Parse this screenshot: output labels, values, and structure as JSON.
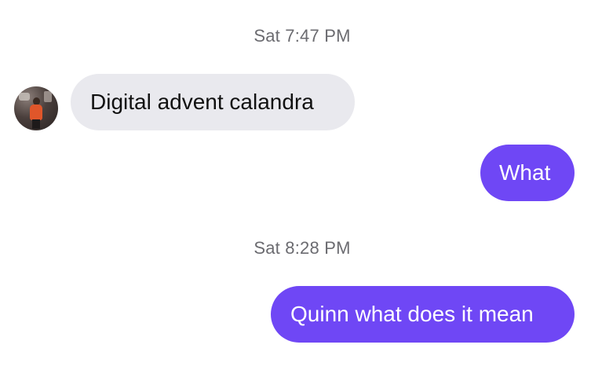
{
  "conversation": {
    "timestamps": [
      "Sat 7:47 PM",
      "Sat 8:28 PM"
    ],
    "messages": [
      {
        "sender": "contact",
        "text": "Digital advent calandra"
      },
      {
        "sender": "me",
        "text": "What"
      },
      {
        "sender": "me",
        "text": "Quinn what does it mean"
      }
    ]
  },
  "colors": {
    "incoming_bubble": "#e9e9ee",
    "outgoing_bubble": "#6f47f5",
    "timestamp_text": "#6b6b70"
  },
  "icons": {
    "avatar": "contact-avatar-photo"
  }
}
